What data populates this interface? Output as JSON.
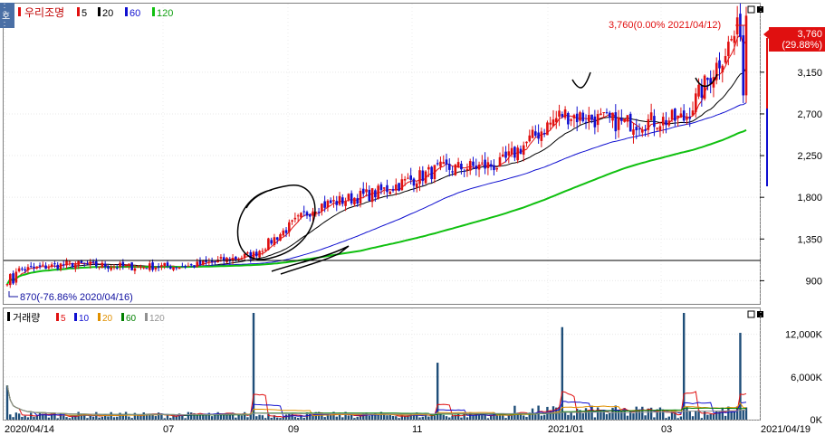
{
  "stock": {
    "name": "우리조명",
    "period_flag": "호"
  },
  "legend": {
    "price": [
      {
        "label": "5",
        "color": "#e01010"
      },
      {
        "label": "20",
        "color": "#000000"
      },
      {
        "label": "60",
        "color": "#1010d0"
      },
      {
        "label": "120",
        "color": "#10c010"
      }
    ],
    "volume_title": "거래량",
    "volume": [
      {
        "label": "5",
        "color": "#e01010"
      },
      {
        "label": "10",
        "color": "#1010d0"
      },
      {
        "label": "20",
        "color": "#e09000"
      },
      {
        "label": "60",
        "color": "#008000"
      },
      {
        "label": "120",
        "color": "#909090"
      }
    ]
  },
  "annotations": {
    "high": "3,760(0.00% 2021/04/12)",
    "low": "870(-76.86% 2020/04/16)",
    "last_price": "3,760",
    "last_change": "(29.88%)"
  },
  "chart_data": [
    {
      "type": "candlestick",
      "title": "우리조명",
      "x_labels": [
        "2020/04/14",
        "07",
        "09",
        "11",
        "2021/01",
        "03",
        "2021/04/19"
      ],
      "y_ticks": [
        "3,150",
        "2,700",
        "2,250",
        "1,800",
        "1,350",
        "900"
      ],
      "ylim": [
        650,
        3900
      ],
      "high": 3760,
      "low": 870,
      "last": 3760,
      "candle_count": 250,
      "ma": [
        {
          "name": "5",
          "color": "#e01010"
        },
        {
          "name": "20",
          "color": "#000000"
        },
        {
          "name": "60",
          "color": "#1010d0"
        },
        {
          "name": "120",
          "color": "#10c010"
        }
      ],
      "close_by_month": [
        {
          "x": "2020/04",
          "y": 1000
        },
        {
          "x": "2020/05",
          "y": 1080
        },
        {
          "x": "2020/06",
          "y": 1050
        },
        {
          "x": "2020/07",
          "y": 1060
        },
        {
          "x": "2020/08",
          "y": 1180
        },
        {
          "x": "2020/09",
          "y": 1700
        },
        {
          "x": "2020/10",
          "y": 1850
        },
        {
          "x": "2020/11",
          "y": 2100
        },
        {
          "x": "2020/12",
          "y": 2150
        },
        {
          "x": "2021/01",
          "y": 2700
        },
        {
          "x": "2021/02",
          "y": 2600
        },
        {
          "x": "2021/03",
          "y": 2650
        },
        {
          "x": "2021/04",
          "y": 3760
        }
      ]
    },
    {
      "type": "bar",
      "title": "거래량",
      "y_ticks": [
        "12,000K",
        "6,000K",
        "0K"
      ],
      "ylim": [
        0,
        15000
      ],
      "ma": [
        "5",
        "10",
        "20",
        "60",
        "120"
      ],
      "spikes": [
        {
          "x": "2020/04",
          "y": 4800
        },
        {
          "x": "2020/08",
          "y": 15000
        },
        {
          "x": "2020/11",
          "y": 8000
        },
        {
          "x": "2021/01",
          "y": 13000
        },
        {
          "x": "2021/03",
          "y": 15000
        },
        {
          "x": "2021/04",
          "y": 12200
        }
      ]
    }
  ]
}
